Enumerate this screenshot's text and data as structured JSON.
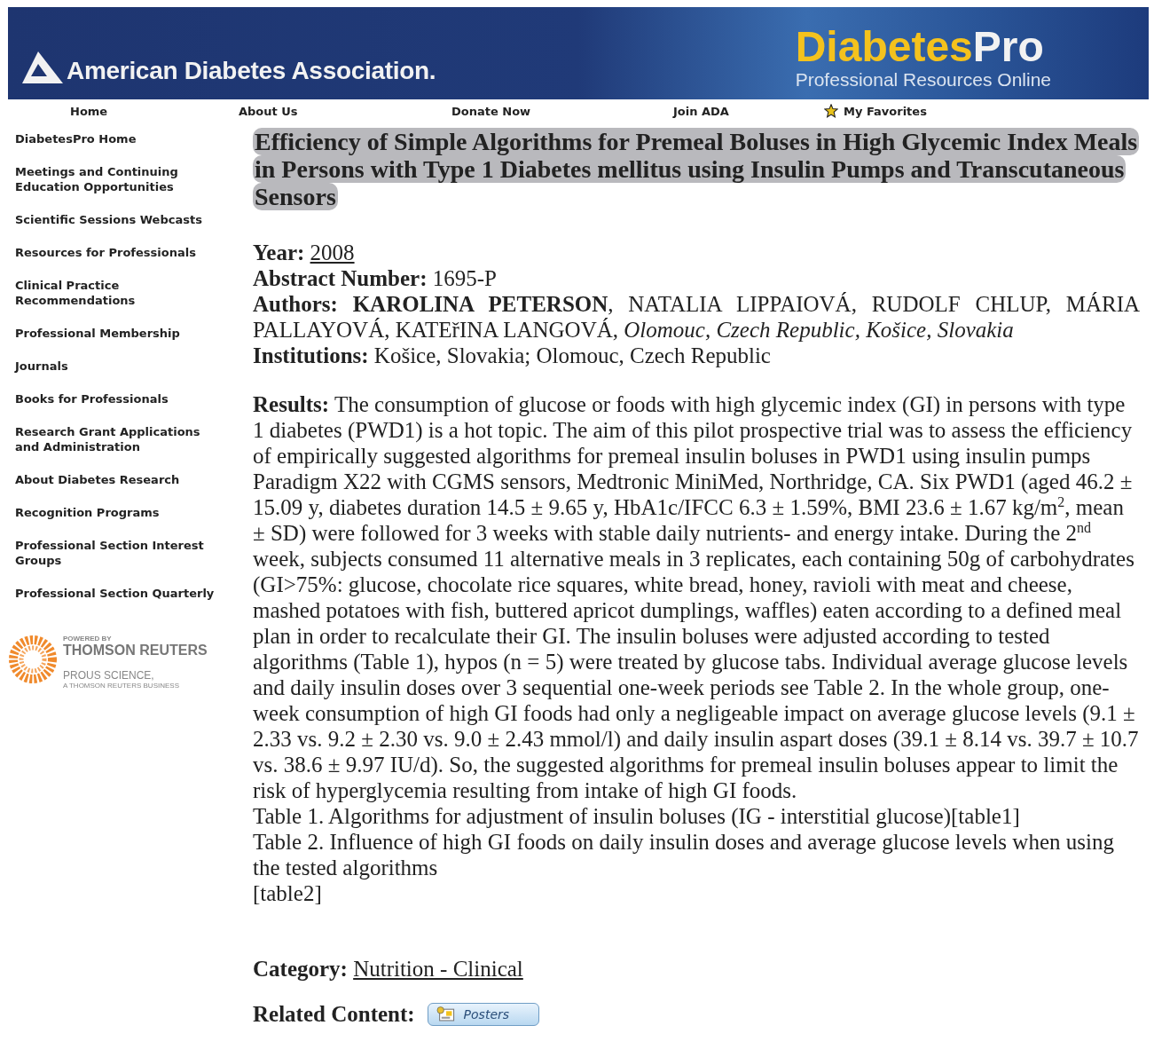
{
  "header": {
    "org_name": "American Diabetes Association.",
    "product_name": "Diabetes",
    "product_suffix": "Pro",
    "tagline": "Professional Resources Online"
  },
  "nav": [
    {
      "label": "Home",
      "kind": "link"
    },
    {
      "label": "About Us",
      "kind": "link"
    },
    {
      "label": "Donate Now",
      "kind": "link"
    },
    {
      "label": "Join ADA",
      "kind": "link"
    },
    {
      "label": "My Favorites",
      "kind": "favorite"
    }
  ],
  "sidebar": {
    "items": [
      "DiabetesPro Home",
      "Meetings and Continuing Education Opportunities",
      "Scientific Sessions Webcasts",
      "Resources for Professionals",
      "Clinical Practice Recommendations",
      "Professional Membership",
      "Journals",
      "Books for Professionals",
      "Research Grant Applications and Administration",
      "About Diabetes Research",
      "Recognition Programs",
      "Professional Section Interest Groups",
      "Professional Section Quarterly"
    ],
    "sponsor": {
      "caption": "POWERED BY",
      "name": "THOMSON REUTERS",
      "division": "PROUS SCIENCE,",
      "division_note": "A THOMSON REUTERS BUSINESS"
    }
  },
  "article": {
    "title": "Efficiency of Simple Algorithms for Premeal Boluses in High Glycemic Index Meals in Persons with Type 1 Diabetes mellitus using Insulin Pumps and Transcutaneous Sensors",
    "year_label": "Year:",
    "year": "2008",
    "abstract_label": "Abstract Number:",
    "abstract_number": "1695-P",
    "authors_label": "Authors:",
    "authors": "**KAROLINA PETERSON**, NATALIA LIPPAIOVÁ, RUDOLF CHLUP, MÁRIA PALLAYOVÁ, KATEřINA LANGOVÁ, *Olomouc, Czech Republic, Košice, Slovakia*",
    "institutions_label": "Institutions:",
    "institutions": "Košice, Slovakia; Olomouc, Czech Republic",
    "results_label": "Results:",
    "results": "The consumption of glucose or foods with high glycemic index (GI) in persons with type 1 diabetes (PWD1) is a hot topic. The aim of this pilot prospective trial was to assess the efficiency of empirically suggested algorithms for premeal insulin boluses in PWD1 using insulin pumps Paradigm X22 with CGMS sensors, Medtronic MiniMed, Northridge, CA. Six PWD1 (aged 46.2 ± 15.09 y, diabetes duration 14.5 ± 9.65 y, HbA1c/IFCC 6.3 ± 1.59%, BMI 23.6 ± 1.67 kg/m$^{2}$, mean ± SD) were followed for 3 weeks with stable daily nutrients- and energy intake. During the 2$^{nd}$ week, subjects consumed 11 alternative meals in 3 replicates, each containing 50g of carbohydrates (GI>75%: glucose, chocolate rice squares, white bread, honey, ravioli with meat and cheese, mashed potatoes with fish, buttered apricot dumplings, waffles) eaten according to a defined meal plan in order to recalculate their GI. The insulin boluses were adjusted according to tested algorithms (Table 1), hypos (n = 5) were treated by glucose tabs. Individual average glucose levels and daily insulin doses over 3 sequential one-week periods see Table 2. In the whole group, one-week consumption of high GI foods had only a negligeable impact on average glucose levels (9.1 ± 2.33 vs. 9.2 ± 2.30 vs. 9.0 ± 2.43 mmol/l) and daily insulin aspart doses (39.1 ± 8.14 vs. 39.7 ± 10.7 vs. 38.6 ± 9.97 IU/d). So, the suggested algorithms for premeal insulin boluses appear to limit the risk of hyperglycemia resulting from intake of high GI foods.",
    "notes": [
      "Table 1. Algorithms for adjustment of insulin boluses (IG - interstitial glucose)[table1]",
      "Table 2. Influence of high GI foods on daily insulin doses and average glucose levels when using the tested algorithms",
      "[table2]"
    ],
    "category_label": "Category:",
    "category": "Nutrition - Clinical",
    "related_label": "Related Content:",
    "related_button": "Posters"
  }
}
